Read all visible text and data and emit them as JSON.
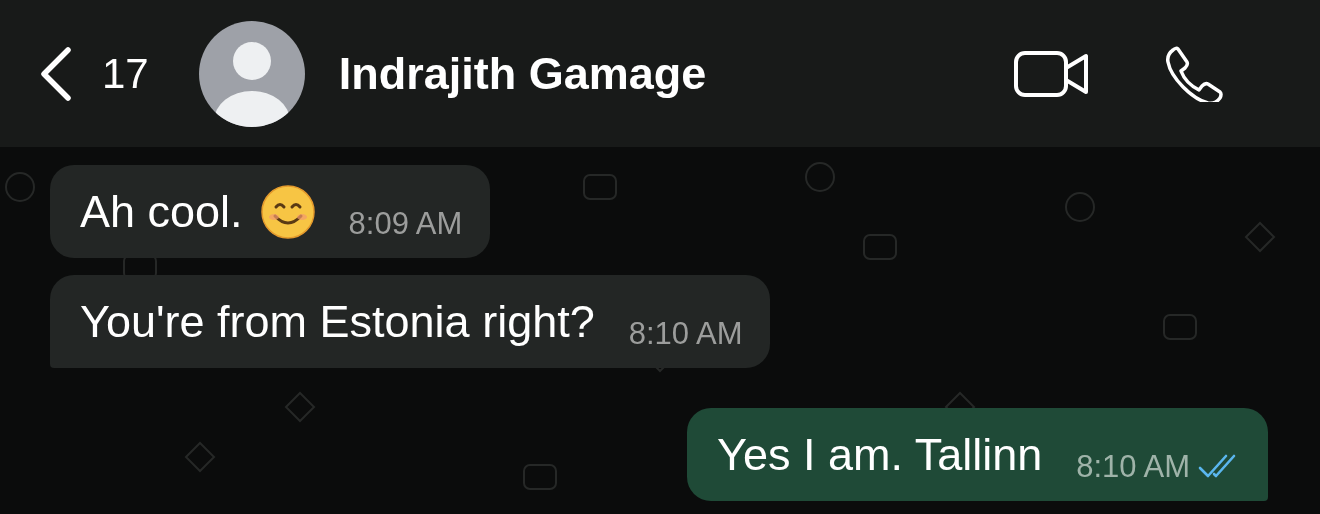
{
  "header": {
    "back_count": "17",
    "contact_name": "Indrajith Gamage"
  },
  "messages": [
    {
      "kind": "incoming",
      "text": "Ah cool.",
      "smiley": true,
      "time": "8:09 AM",
      "tail": false
    },
    {
      "kind": "incoming",
      "text": "You're from Estonia right?",
      "time": "8:10 AM",
      "tail": true
    },
    {
      "kind": "outgoing",
      "text": "Yes I am. Tallinn",
      "time": "8:10 AM",
      "tail": true,
      "read": true
    }
  ]
}
